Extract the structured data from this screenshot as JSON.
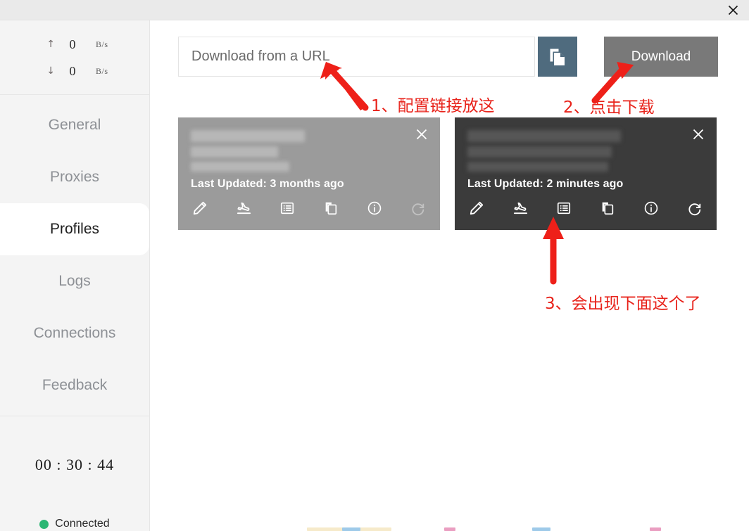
{
  "window": {
    "close_label": "×",
    "close_icon": "close-icon"
  },
  "sidebar": {
    "speeds": [
      {
        "icon": "upload-arrow-icon",
        "arrow": "↑",
        "value": "0",
        "unit": "B/s"
      },
      {
        "icon": "download-arrow-icon",
        "arrow": "↓",
        "value": "0",
        "unit": "B/s"
      }
    ],
    "nav_items": [
      {
        "label": "General",
        "active": false
      },
      {
        "label": "Proxies",
        "active": false
      },
      {
        "label": "Profiles",
        "active": true
      },
      {
        "label": "Logs",
        "active": false
      },
      {
        "label": "Connections",
        "active": false
      },
      {
        "label": "Feedback",
        "active": false
      }
    ],
    "timer": "00 : 30 : 44",
    "status": {
      "text": "Connected",
      "color": "#2bb673"
    }
  },
  "toolbar": {
    "url_placeholder": "Download from a URL",
    "url_value": "",
    "paste_icon": "paste-clipboard-icon",
    "download_label": "Download",
    "download_color": "#797979",
    "paste_color": "#4f6b7e"
  },
  "profiles": [
    {
      "name_redacted": true,
      "updated": "Last Updated: 3 months ago",
      "active": false,
      "background": "#9b9b9b",
      "actions": [
        {
          "icon": "pencil-edit-icon",
          "label": "Edit",
          "disabled": false
        },
        {
          "icon": "plane-landing-icon",
          "label": "Apply",
          "disabled": false
        },
        {
          "icon": "list-rules-icon",
          "label": "Rules",
          "disabled": false
        },
        {
          "icon": "copy-duplicate-icon",
          "label": "Copy",
          "disabled": false
        },
        {
          "icon": "info-circle-icon",
          "label": "Info",
          "disabled": false
        },
        {
          "icon": "refresh-update-icon",
          "label": "Update",
          "disabled": true
        }
      ]
    },
    {
      "name_redacted": true,
      "updated": "Last Updated: 2 minutes ago",
      "active": true,
      "background": "#3b3b3b",
      "actions": [
        {
          "icon": "pencil-edit-icon",
          "label": "Edit",
          "disabled": false
        },
        {
          "icon": "plane-landing-icon",
          "label": "Apply",
          "disabled": false
        },
        {
          "icon": "list-rules-icon",
          "label": "Rules",
          "disabled": false
        },
        {
          "icon": "copy-duplicate-icon",
          "label": "Copy",
          "disabled": false
        },
        {
          "icon": "info-circle-icon",
          "label": "Info",
          "disabled": false
        },
        {
          "icon": "refresh-update-icon",
          "label": "Update",
          "disabled": false
        }
      ]
    }
  ],
  "annotations": {
    "color": "#e8231b",
    "items": [
      {
        "text": "1、配置链接放这"
      },
      {
        "text": "2、点击下载"
      },
      {
        "text": "3、会出现下面这个了"
      }
    ]
  }
}
